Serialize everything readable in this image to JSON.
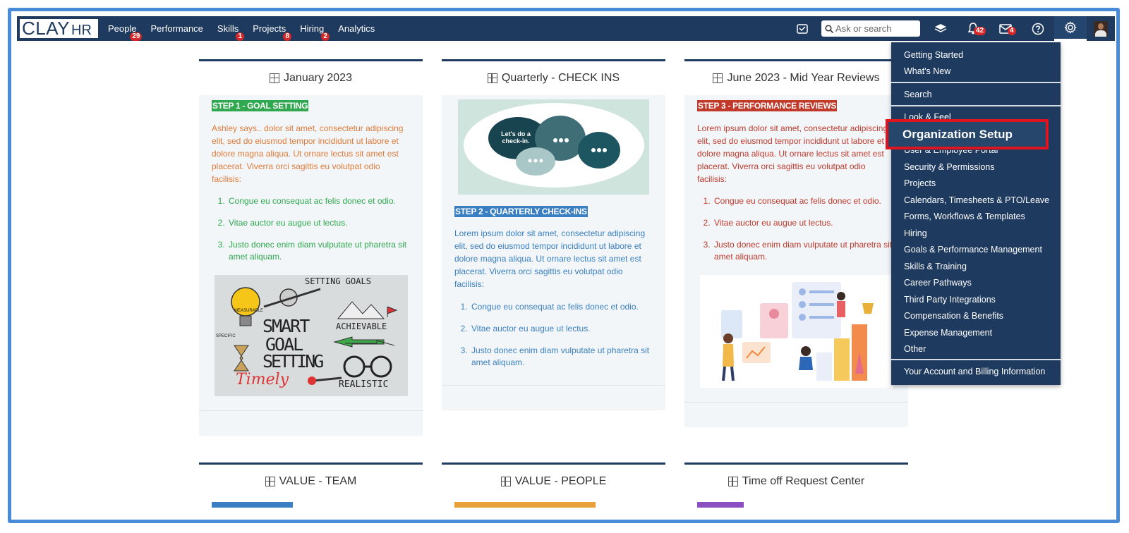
{
  "logo": {
    "part1": "CLAY",
    "part2": "HR"
  },
  "nav": {
    "items": [
      {
        "label": "People",
        "badge": "29"
      },
      {
        "label": "Performance",
        "badge": ""
      },
      {
        "label": "Skills",
        "badge": "1"
      },
      {
        "label": "Projects",
        "badge": "8"
      },
      {
        "label": "Hiring",
        "badge": "2"
      },
      {
        "label": "Analytics",
        "badge": ""
      }
    ],
    "search_placeholder": "Ask or search",
    "notifications_badge": "42",
    "mail_badge": "4"
  },
  "cards": {
    "c1": {
      "title": "January 2023",
      "step": "STEP 1 - GOAL SETTING",
      "step_color": "#2fa84f",
      "intro": "Ashley says.. dolor sit amet, consectetur adipiscing elit, sed do eiusmod tempor incididunt ut labore et dolore magna aliqua. Ut ornare lectus sit amet est placerat. Viverra orci sagittis eu volutpat odio facilisis:",
      "items": [
        "Congue eu consequat ac felis donec et odio.",
        "Vitae auctor eu augue ut lectus.",
        "Justo donec enim diam vulputate ut pharetra sit amet aliquam."
      ],
      "image_text": {
        "title": "SETTING GOALS",
        "smart": "SMART",
        "goal": "GOAL",
        "setting": "SETTING",
        "achievable": "ACHIEVABLE",
        "realistic": "REALISTIC",
        "timely": "Timely",
        "measurable": "MEASURABLE",
        "specific": "SPECIFIC"
      }
    },
    "c2": {
      "title": "Quarterly - CHECK INS",
      "bubble": "Let's do a check-in.",
      "step": "STEP 2 - QUARTERLY CHECK-INS",
      "step_color": "#3a7fc1",
      "intro": "Lorem ipsum dolor sit amet, consectetur adipiscing elit, sed do eiusmod tempor incididunt ut labore et dolore magna aliqua. Ut ornare lectus sit amet est placerat. Viverra orci sagittis eu volutpat odio facilisis:",
      "items": [
        "Congue eu consequat ac felis donec et odio.",
        "Vitae auctor eu augue ut lectus.",
        "Justo donec enim diam vulputate ut pharetra sit amet aliquam."
      ]
    },
    "c3": {
      "title": "June 2023 - Mid Year Reviews",
      "step": "STEP 3 - PERFORMANCE REVIEWS",
      "step_color": "#c0392b",
      "intro": "Lorem ipsum dolor sit amet, consectetur adipiscing elit, sed do eiusmod tempor incididunt ut labore et dolore magna aliqua. Ut ornare lectus sit amet est placerat. Viverra orci sagittis eu volutpat odio facilisis:",
      "items": [
        "Congue eu consequat ac felis donec et odio.",
        "Vitae auctor eu augue ut lectus.",
        "Justo donec enim diam vulputate ut pharetra sit amet aliquam."
      ]
    },
    "c4": {
      "title": "VALUE - TEAM"
    },
    "c5": {
      "title": "VALUE - PEOPLE"
    },
    "c6": {
      "title": "Time off Request Center"
    }
  },
  "menu": {
    "getting_started": "Getting Started",
    "whats_new": "What's New",
    "search": "Search",
    "look_feel": "Look & Feel",
    "org_setup": "Organization Setup",
    "user_portal": "User & Employee Portal",
    "security": "Security & Permissions",
    "projects": "Projects",
    "calendars": "Calendars, Timesheets & PTO/Leave",
    "forms": "Forms, Workflows & Templates",
    "hiring": "Hiring",
    "goals": "Goals & Performance Management",
    "skills": "Skills & Training",
    "career": "Career Pathways",
    "third_party": "Third Party Integrations",
    "compensation": "Compensation & Benefits",
    "expense": "Expense Management",
    "other": "Other",
    "account": "Your Account and Billing Information"
  },
  "colors": {
    "nav": "#1e3a5f",
    "accent_red": "#e0141e",
    "green": "#2fa84f",
    "blue": "#3a7fc1",
    "red": "#c0392b"
  }
}
